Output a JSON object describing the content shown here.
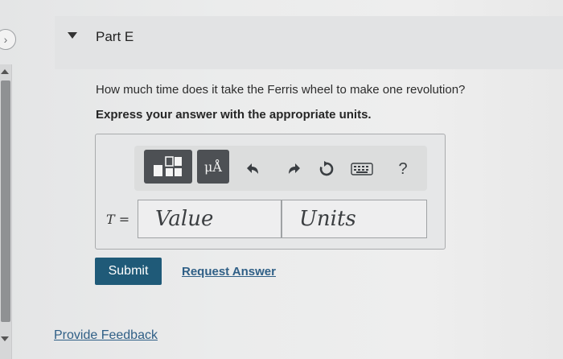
{
  "part": {
    "title": "Part E"
  },
  "question": {
    "text": "How much time does it take the Ferris wheel to make one revolution?",
    "instruction": "Express your answer with the appropriate units."
  },
  "toolbar": {
    "units_symbol": "μÅ",
    "help_label": "?",
    "icons": [
      "template-icon",
      "units-icon",
      "undo-icon",
      "redo-icon",
      "reset-icon",
      "keyboard-icon",
      "help-icon"
    ]
  },
  "answer": {
    "variable": "T",
    "equals": "=",
    "value_placeholder": "Value",
    "units_placeholder": "Units"
  },
  "actions": {
    "submit_label": "Submit",
    "request_label": "Request Answer"
  },
  "footer": {
    "feedback_label": "Provide Feedback"
  },
  "colors": {
    "accent": "#1f5a78",
    "link": "#2f5f86",
    "toolbar_button": "#4d5054"
  }
}
